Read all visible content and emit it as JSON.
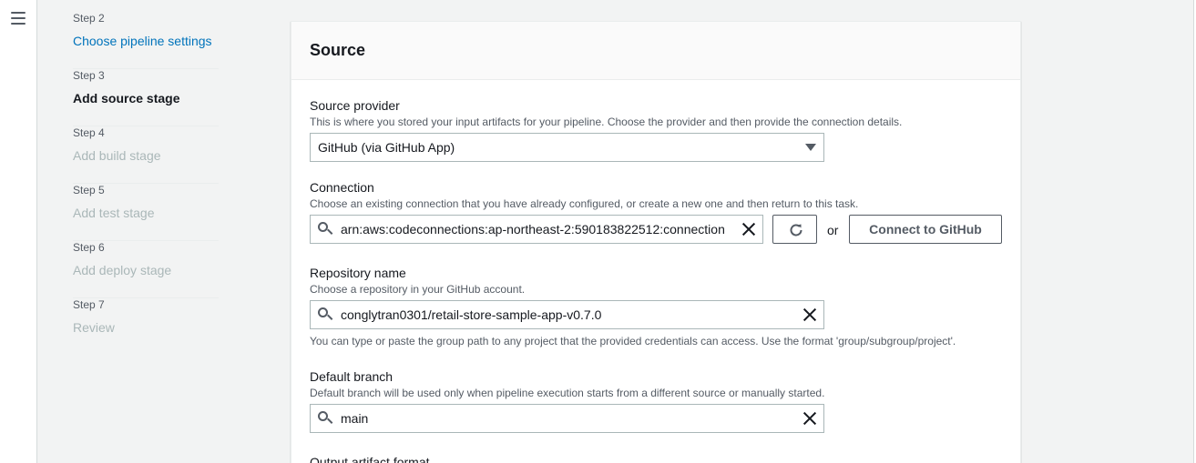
{
  "wizard_steps": [
    {
      "step": "Step 2",
      "title": "Choose pipeline settings",
      "state": "link"
    },
    {
      "step": "Step 3",
      "title": "Add source stage",
      "state": "current"
    },
    {
      "step": "Step 4",
      "title": "Add build stage",
      "state": "disabled"
    },
    {
      "step": "Step 5",
      "title": "Add test stage",
      "state": "disabled"
    },
    {
      "step": "Step 6",
      "title": "Add deploy stage",
      "state": "disabled"
    },
    {
      "step": "Step 7",
      "title": "Review",
      "state": "disabled"
    }
  ],
  "panel": {
    "title": "Source",
    "source_provider": {
      "label": "Source provider",
      "description": "This is where you stored your input artifacts for your pipeline. Choose the provider and then provide the connection details.",
      "value": "GitHub (via GitHub App)"
    },
    "connection": {
      "label": "Connection",
      "description": "Choose an existing connection that you have already configured, or create a new one and then return to this task.",
      "value": "arn:aws:codeconnections:ap-northeast-2:590183822512:connection",
      "or_text": "or",
      "connect_button": "Connect to GitHub"
    },
    "repository": {
      "label": "Repository name",
      "description": "Choose a repository in your GitHub account.",
      "value": "conglytran0301/retail-store-sample-app-v0.7.0",
      "hint": "You can type or paste the group path to any project that the provided credentials can access. Use the format 'group/subgroup/project'."
    },
    "default_branch": {
      "label": "Default branch",
      "description": "Default branch will be used only when pipeline execution starts from a different source or manually started.",
      "value": "main"
    },
    "output_artifact": {
      "label": "Output artifact format"
    }
  },
  "colors": {
    "link": "#0073bb",
    "disabled": "#aab7b8",
    "background": "#f2f3f3"
  }
}
